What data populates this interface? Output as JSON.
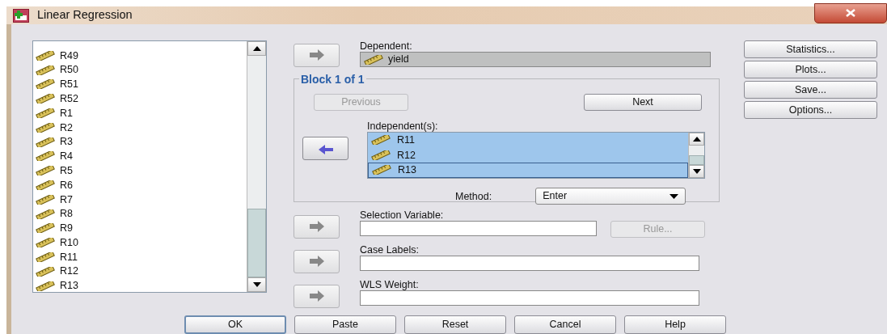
{
  "window": {
    "title": "Linear Regression"
  },
  "variables": [
    {
      "name": "R49"
    },
    {
      "name": "R50"
    },
    {
      "name": "R51"
    },
    {
      "name": "R52"
    },
    {
      "name": "R1"
    },
    {
      "name": "R2"
    },
    {
      "name": "R3"
    },
    {
      "name": "R4"
    },
    {
      "name": "R5"
    },
    {
      "name": "R6"
    },
    {
      "name": "R7"
    },
    {
      "name": "R8"
    },
    {
      "name": "R9"
    },
    {
      "name": "R10"
    },
    {
      "name": "R11"
    },
    {
      "name": "R12"
    },
    {
      "name": "R13"
    }
  ],
  "dependent": {
    "label": "Dependent:",
    "value": "yield",
    "arrow": {
      "kind": "right",
      "disabled": true
    }
  },
  "block": {
    "title": "Block 1 of 1",
    "previous": {
      "label": "Previous",
      "disabled": true
    },
    "next": {
      "label": "Next",
      "disabled": false
    },
    "independents_label": "Independent(s):",
    "arrow": {
      "kind": "left",
      "disabled": false
    },
    "independents": [
      {
        "name": "R11",
        "selected": true,
        "focused": false
      },
      {
        "name": "R12",
        "selected": true,
        "focused": false
      },
      {
        "name": "R13",
        "selected": true,
        "focused": true
      }
    ],
    "method_label": "Method:",
    "method": "Enter"
  },
  "fields": [
    {
      "label": "Selection Variable:",
      "arrow": {
        "kind": "right",
        "disabled": true
      },
      "rule": {
        "label": "Rule...",
        "disabled": true
      }
    },
    {
      "label": "Case Labels:",
      "arrow": {
        "kind": "right",
        "disabled": true
      }
    },
    {
      "label": "WLS Weight:",
      "arrow": {
        "kind": "right",
        "disabled": true
      }
    }
  ],
  "side_buttons": [
    "Statistics...",
    "Plots...",
    "Save...",
    "Options..."
  ],
  "footer_buttons": [
    {
      "label": "OK",
      "default": true
    },
    {
      "label": "Paste",
      "default": false
    },
    {
      "label": "Reset",
      "default": false
    },
    {
      "label": "Cancel",
      "default": false
    },
    {
      "label": "Help",
      "default": false
    }
  ]
}
